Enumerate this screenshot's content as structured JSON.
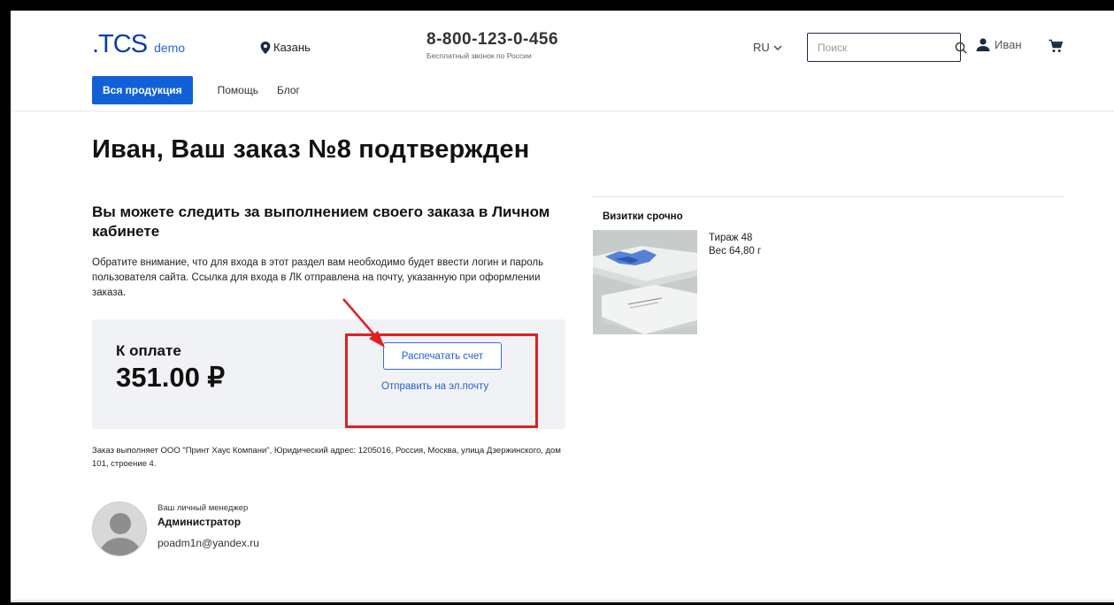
{
  "header": {
    "logo_main": ".TCS",
    "logo_sub": "demo",
    "city": "Казань",
    "phone_number": "8-800-123-0-456",
    "phone_note": "Бесплатный звонок по России",
    "language": "RU",
    "search_placeholder": "Поиск",
    "user_name": "Иван",
    "icons": [
      "location-pin-icon",
      "chevron-down-icon",
      "search-icon",
      "user-icon",
      "cart-icon"
    ]
  },
  "nav": {
    "items": [
      {
        "label": "Вся продукция",
        "active": true
      },
      {
        "label": "Помощь"
      },
      {
        "label": "Блог"
      }
    ]
  },
  "main": {
    "title": "Иван, Ваш заказ №8 подтвержден",
    "subtitle": "Вы можете следить за выполнением своего заказа в Личном кабинете",
    "notice": "Обратите внимание, что для входа в этот раздел вам необходимо будет ввести логин и пароль пользователя сайта. Ссылка для входа в ЛК отправлена на почту, указанную при оформлении заказа.",
    "payment": {
      "label": "К оплате",
      "amount": "351.00 ₽",
      "print_button": "Распечатать счет",
      "email_link": "Отправить на эл.почту"
    },
    "legal": "Заказ выполняет ООО \"Принт Хаус Компани\", Юридический адрес: 1205016, Россия, Москва, улица Дзержинского, дом 101, строение 4.",
    "manager": {
      "role": "Ваш личный менеджер",
      "name": "Администратор",
      "email": "poadm1n@yandex.ru"
    }
  },
  "order_item": {
    "title": "Визитки срочно",
    "circulation": "Тираж 48",
    "weight": "Вес 64,80 г"
  },
  "colors": {
    "brand_blue": "#1160d8",
    "logo_blue": "#0b3fa6",
    "link_blue": "#1f5fd6",
    "annotation_red": "#e02020",
    "panel_bg": "#f1f2f5"
  }
}
